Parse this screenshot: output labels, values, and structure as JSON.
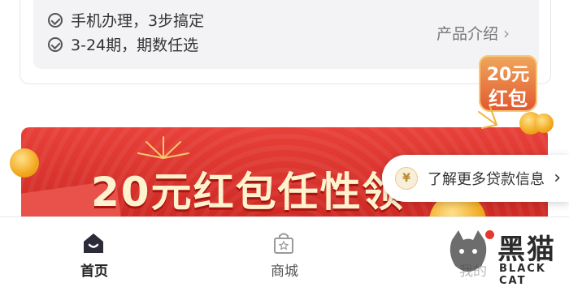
{
  "product_card": {
    "features": [
      "手机办理，3步搞定",
      "3-24期，期数任选"
    ],
    "intro_link": "产品介绍"
  },
  "float_badge": {
    "line1": "20元",
    "line2": "红包"
  },
  "banner": {
    "title": "20元红包任性领"
  },
  "float_pill": {
    "label": "了解更多贷款信息",
    "icon": "yuan-coin-icon"
  },
  "tabbar": {
    "tabs": [
      {
        "label": "首页",
        "icon": "home-icon",
        "active": true
      },
      {
        "label": "商城",
        "icon": "shop-bag-icon",
        "active": false
      },
      {
        "label": "我的",
        "icon": "profile-icon",
        "active": false
      }
    ]
  },
  "watermark": {
    "cn": "黑猫",
    "en": "BLACK CAT"
  },
  "colors": {
    "banner_red": "#d5302a",
    "badge_orange": "#e86a3a",
    "text_dark": "#333333",
    "muted": "#777777"
  }
}
